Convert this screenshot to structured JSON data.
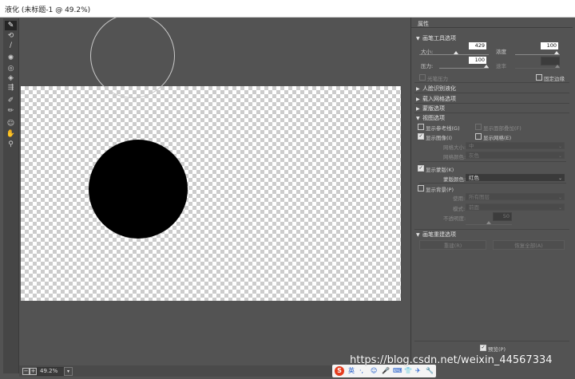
{
  "window": {
    "title": "液化 (未标题-1 @ 49.2%)"
  },
  "tools": [
    {
      "icon": "forward-warp-icon",
      "glyph": "✎"
    },
    {
      "icon": "reconstruct-icon",
      "glyph": "⟲"
    },
    {
      "icon": "smooth-icon",
      "glyph": "∕"
    },
    {
      "icon": "twirl-icon",
      "glyph": "✺"
    },
    {
      "icon": "pucker-icon",
      "glyph": "◎"
    },
    {
      "icon": "bloat-icon",
      "glyph": "◈"
    },
    {
      "icon": "push-left-icon",
      "glyph": "⇶"
    },
    {
      "icon": "freeze-mask-icon",
      "glyph": "✐"
    },
    {
      "icon": "thaw-mask-icon",
      "glyph": "✏"
    },
    {
      "icon": "face-tool-icon",
      "glyph": "☺"
    },
    {
      "icon": "hand-icon",
      "glyph": "✋"
    },
    {
      "icon": "zoom-icon",
      "glyph": "⚲"
    }
  ],
  "status": {
    "zoom": "49.2%",
    "zoom_out": "−",
    "zoom_in": "+",
    "dropdown": "▾"
  },
  "panel": {
    "title": "属性",
    "brush_tool_options": {
      "header": "画笔工具选项",
      "size_label": "大小:",
      "size": "429",
      "density_label": "浓度",
      "density": "100",
      "pressure_label": "压力:",
      "pressure": "100",
      "rate_label": "速率",
      "rate": "",
      "stylus_label": "光笔压力",
      "pin_edges_label": "固定边缘"
    },
    "face_aware": "人脸识别液化",
    "load_mesh": "载入网格选项",
    "mask_options": "蒙版选项",
    "view_options": {
      "header": "视图选项",
      "show_guides": "显示参考线(G)",
      "show_face_overlay": "显示面部叠加(F)",
      "show_image": "显示图像(I)",
      "show_mesh": "显示网格(E)",
      "mesh_size_label": "网格大小:",
      "mesh_size": "中",
      "mesh_color_label": "网格颜色:",
      "mesh_color": "灰色",
      "show_mask": "显示蒙版(K)",
      "mask_color_label": "蒙版颜色:",
      "mask_color": "红色",
      "show_backdrop": "显示背景(P)",
      "use_label": "使用:",
      "use": "所有图层",
      "mode_label": "模式:",
      "mode": "前面",
      "opacity_label": "不透明度:",
      "opacity": "50"
    },
    "brush_reconstruct": {
      "header": "画笔重建选项",
      "reconstruct": "重建(R)",
      "restore_all": "恢复全部(A)"
    },
    "preview": "预览(P)"
  },
  "taskbar": {
    "logo": "S",
    "lang": "英",
    "items": [
      "·,",
      "☺",
      "🎤",
      "⌨",
      "👕",
      "✈",
      "🔧"
    ]
  },
  "watermark": "https://blog.csdn.net/weixin_44567334"
}
